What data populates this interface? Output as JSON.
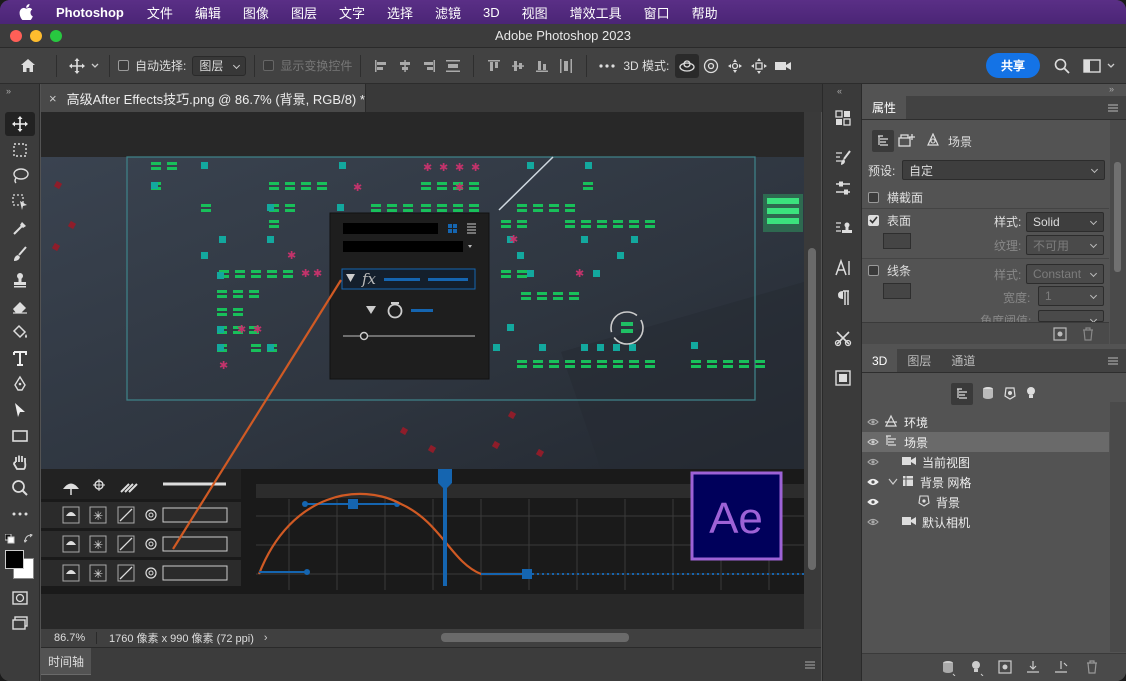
{
  "menubar": {
    "app_name": "Photoshop",
    "items": [
      "文件",
      "编辑",
      "图像",
      "图层",
      "文字",
      "选择",
      "滤镜",
      "3D",
      "视图",
      "增效工具",
      "窗口",
      "帮助"
    ]
  },
  "window": {
    "title": "Adobe Photoshop 2023"
  },
  "options_bar": {
    "auto_select_label": "自动选择:",
    "auto_select_value": "图层",
    "show_transform_label": "显示变换控件",
    "mode_3d_label": "3D 模式:",
    "share_label": "共享"
  },
  "document": {
    "tab_title": "高级After Effects技巧.png @ 86.7% (背景, RGB/8) *",
    "zoom": "86.7%",
    "info": "1760 像素 x 990 像素 (72 ppi)"
  },
  "timeline_panel": {
    "title": "时间轴"
  },
  "properties_panel": {
    "title": "属性",
    "scene_label": "场景",
    "preset_label": "预设:",
    "preset_value": "自定",
    "cross_section_label": "横截面",
    "surface_label": "表面",
    "style_label": "样式:",
    "style_value": "Solid",
    "texture_label": "纹理:",
    "texture_value": "不可用",
    "lines_label": "线条",
    "lines_style_label": "样式:",
    "lines_style_value": "Constant",
    "width_label": "宽度:",
    "width_value": "1",
    "angle_label": "角度阈值:"
  },
  "layers_panel": {
    "tabs": [
      "3D",
      "图层",
      "通道"
    ],
    "items": [
      {
        "label": "环境"
      },
      {
        "label": "场景"
      },
      {
        "label": "当前视图"
      },
      {
        "label": "背景 网格"
      },
      {
        "label": "背景"
      },
      {
        "label": "默认相机"
      }
    ]
  },
  "artwork": {
    "ae_logo_text": "Ae"
  },
  "colors": {
    "accent": "#1473e6",
    "menubar": "#4b2576",
    "ae_purple": "#9d62d6",
    "curve": "#d05a24",
    "handle_blue": "#1565b0"
  }
}
